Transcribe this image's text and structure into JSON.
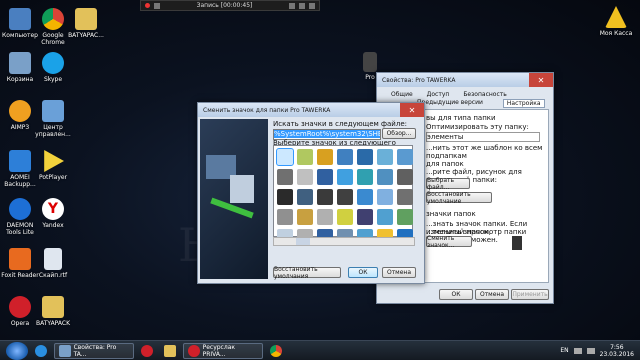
{
  "recording_bar": {
    "title": "Запись [00:00:45]"
  },
  "desktop_icons": [
    {
      "label": "Компьютер",
      "color": "#4a7fc0"
    },
    {
      "label": "Google Chrome",
      "color": "#e8b32a"
    },
    {
      "label": "BATYAPAC...",
      "color": "#e2c15a"
    },
    {
      "label": "Корзина",
      "color": "#7aa0c8"
    },
    {
      "label": "Skype",
      "color": "#1aa2e8"
    },
    {
      "label": "AIMP3",
      "color": "#f0a020"
    },
    {
      "label": "Центр управлен...",
      "color": "#6aa0d8"
    },
    {
      "label": "AOMEI Backupp...",
      "color": "#2d7fd8"
    },
    {
      "label": "PotPlayer",
      "color": "#f2d23c"
    },
    {
      "label": "DAEMON Tools Lite",
      "color": "#1d6fd6"
    },
    {
      "label": "Yandex",
      "color": "#ffffff"
    },
    {
      "label": "Foxit Reader",
      "color": "#e86a1f"
    },
    {
      "label": "Скайп.rtf",
      "color": "#dfe6ef"
    },
    {
      "label": "Opera",
      "color": "#d0202a"
    },
    {
      "label": "BATYAPACK",
      "color": "#e2c15a"
    },
    {
      "label": "Pro",
      "color": "#444444"
    },
    {
      "label": "Моя Касса",
      "color": "#f0c020"
    }
  ],
  "watermark": "Ь",
  "props_window": {
    "title": "Свойства: Pro TAWERKA",
    "tabs": [
      "Общие",
      "Доступ",
      "Безопасность",
      "Предыдущие версии",
      "Настройка"
    ],
    "active_tab": "Настройка",
    "lines": [
      "вы для типа папки",
      "Оптимизировать эту папку:",
      "элементы",
      "...нить этот же шаблон ко всем подпапкам",
      "для папок",
      "...рите файл, рисунок для значка этой папки:",
      "...брать файл...",
      "...становить умолчание",
      "значки папок",
      "...знать значок папки. Если изменить значок,",
      "...тельный просмотр папки будет невозможен."
    ],
    "buttons": {
      "select_file": "Выбрать файл...",
      "restore": "Восстановить умолчание",
      "change_icon": "Сменить значок...",
      "ok": "ОК",
      "cancel": "Отмена",
      "apply": "Применить"
    }
  },
  "icon_dialog": {
    "title": "Сменить значок для папки Pro TAWERKA",
    "search_label": "Искать значки в следующем файле:",
    "file_path": "%SystemRoot%\\system32\\SHELL32.dll",
    "browse": "Обзор...",
    "select_label": "Выберите значок из следующего списка:",
    "restore": "Восстановить умолчания",
    "ok": "ОК",
    "cancel": "Отмена",
    "icon_colors": [
      "#8a8a8a",
      "#b0c860",
      "#d8a020",
      "#4080c0",
      "#2a6aa8",
      "#6ab0d8",
      "#5a9ad0",
      "#707070",
      "#c0c0c0",
      "#3060a0",
      "#40a0e0",
      "#30a0b0",
      "#5090c0",
      "#606060",
      "#2a2a2a",
      "#406080",
      "#3a3a3a",
      "#404040",
      "#3a8ad0",
      "#80b0e0",
      "#707070",
      "#909090",
      "#c8a040",
      "#b0b0b0",
      "#d0d040",
      "#404070",
      "#50a0d0",
      "#60a060",
      "#c0d0e0",
      "#b0b0b0",
      "#3060a0",
      "#7090b0",
      "#50a0d0",
      "#f0c030",
      "#2070c0"
    ]
  },
  "taskbar": {
    "items": [
      {
        "label": "Свойства: Pro TA...",
        "color": "#7aa0c8"
      },
      {
        "label": "Ресурслак PRIVA...",
        "color": "#d0202a"
      }
    ],
    "lang": "EN",
    "time": "7:56",
    "date": "23.03.2016"
  }
}
